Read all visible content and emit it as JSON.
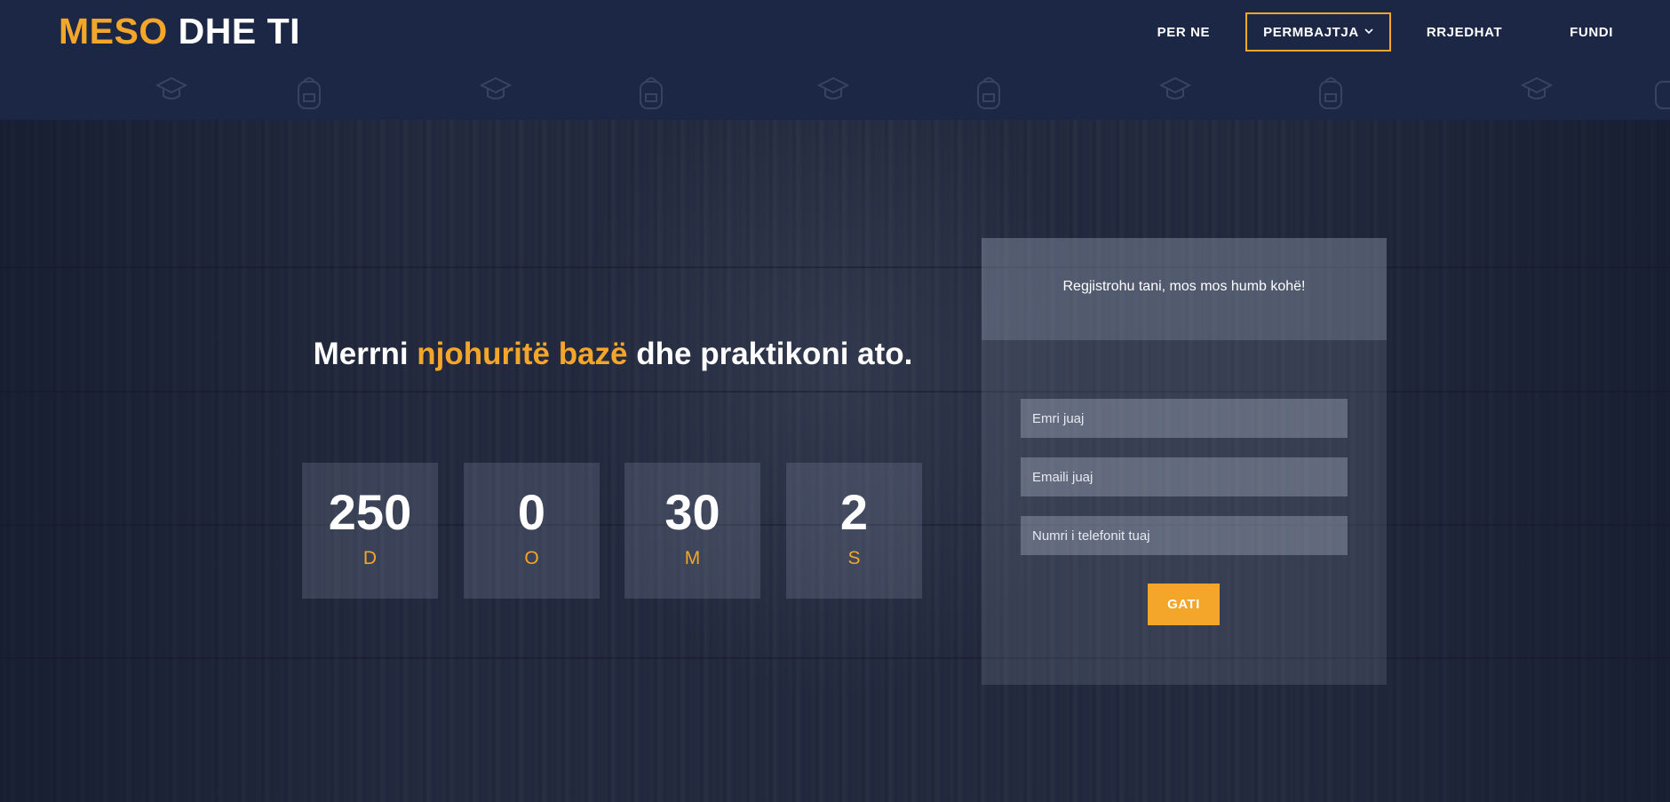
{
  "logo": {
    "part1": "MESO",
    "part2": "DHE TI"
  },
  "nav": {
    "items": [
      {
        "label": "PER NE"
      },
      {
        "label": "PERMBAJTJA"
      },
      {
        "label": "RRJEDHAT"
      },
      {
        "label": "FUNDI"
      }
    ]
  },
  "hero": {
    "headline_start": "Merrni ",
    "headline_highlight": "njohuritë bazë",
    "headline_end": " dhe praktikoni ato."
  },
  "countdown": [
    {
      "value": "250",
      "unit": "D"
    },
    {
      "value": "0",
      "unit": "O"
    },
    {
      "value": "30",
      "unit": "M"
    },
    {
      "value": "2",
      "unit": "S"
    }
  ],
  "form": {
    "title": "Regjistrohu tani, mos mos humb kohë!",
    "name_placeholder": "Emri juaj",
    "email_placeholder": "Emaili juaj",
    "phone_placeholder": "Numri i telefonit tuaj",
    "submit_label": "GATI"
  },
  "colors": {
    "accent": "#f4a62a",
    "header_bg": "#1c2745"
  }
}
